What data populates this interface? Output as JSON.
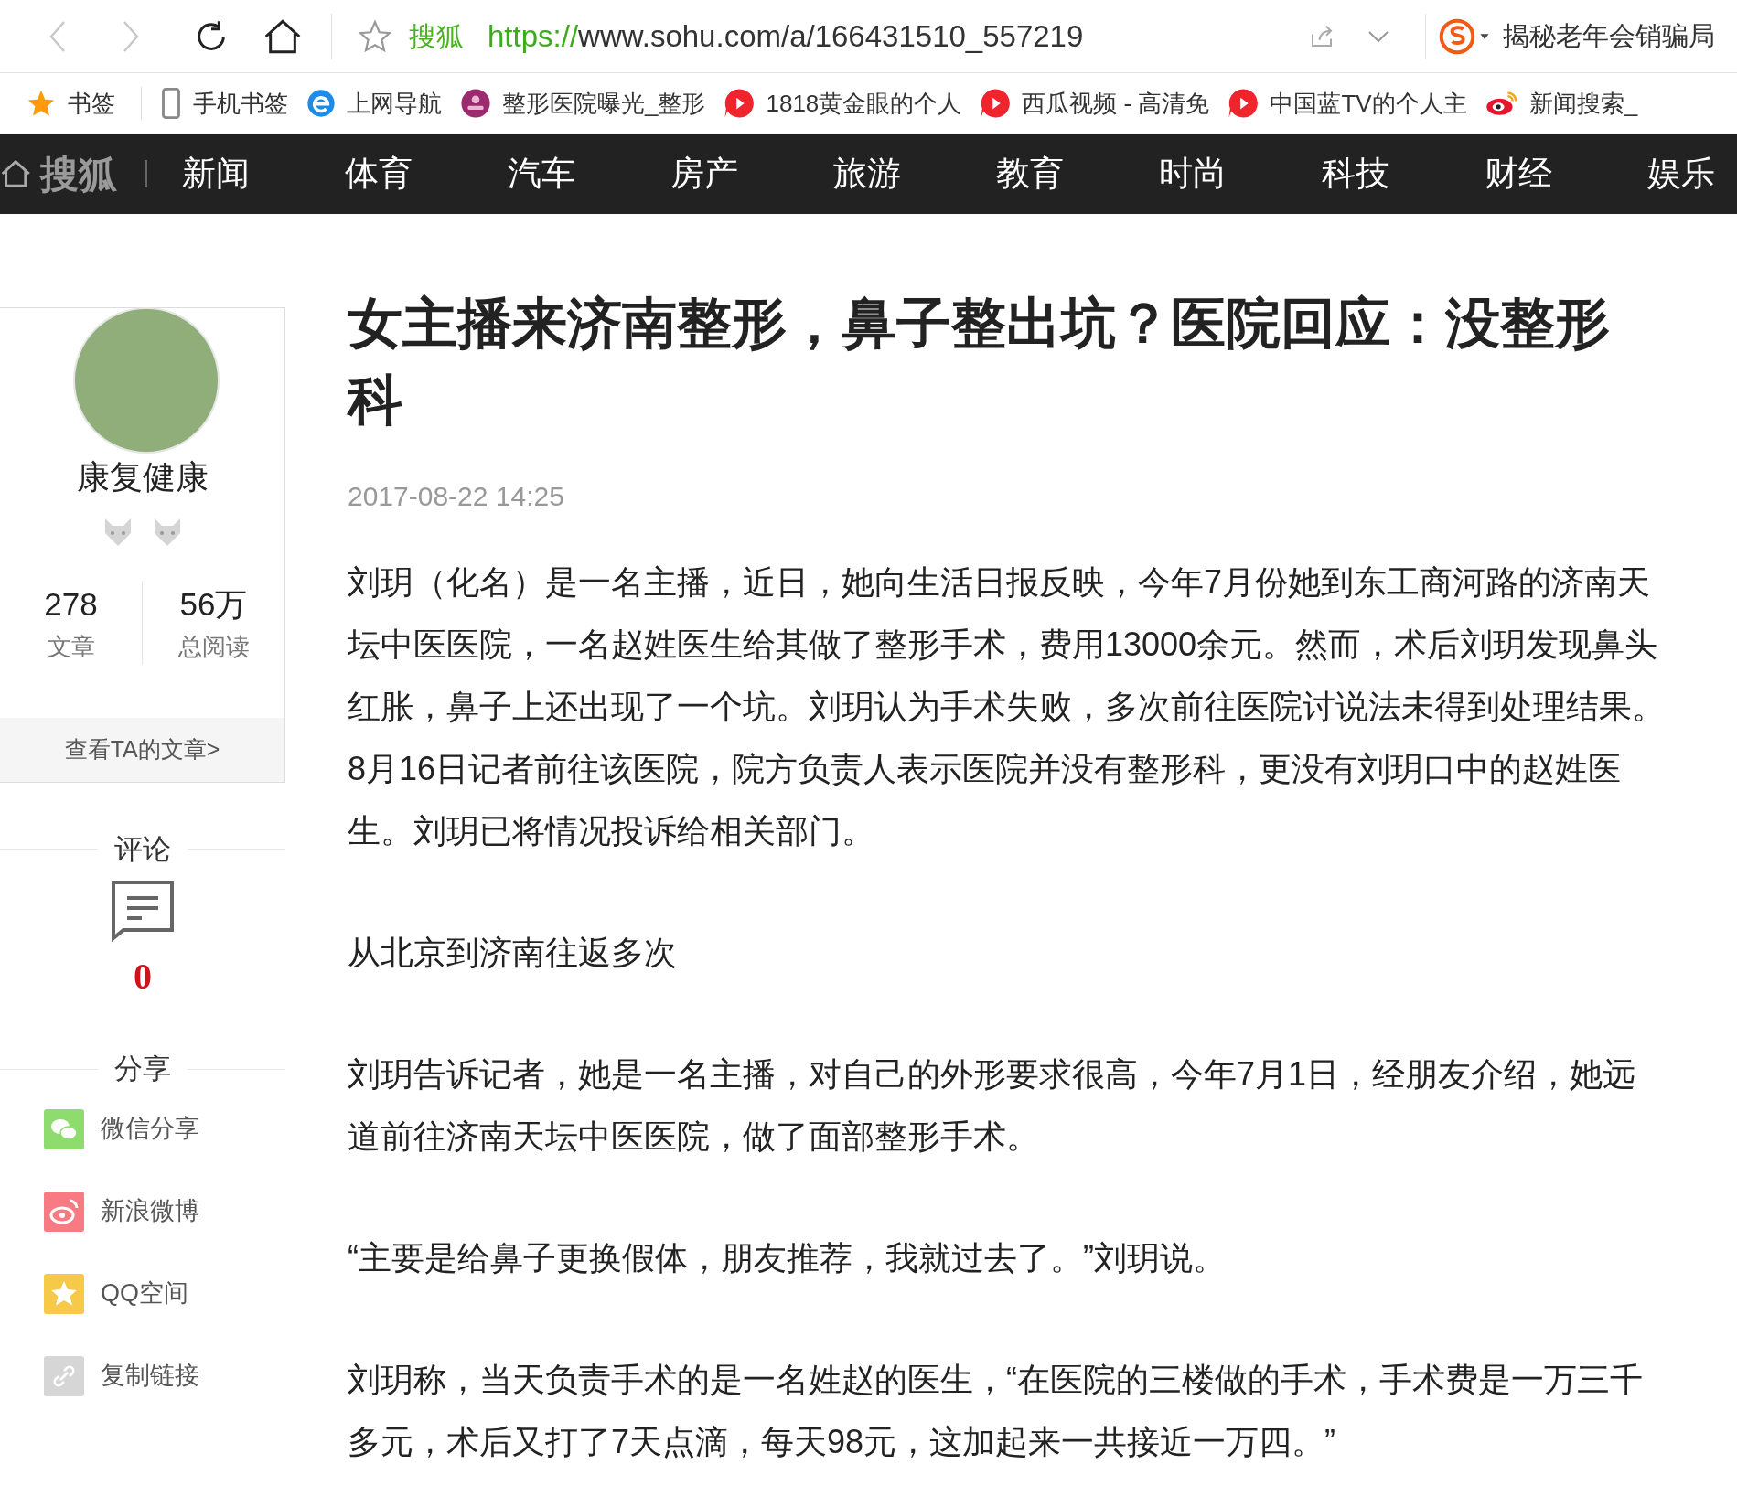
{
  "toolbar": {
    "back_disabled": true,
    "forward_disabled": true,
    "site_name": "搜狐",
    "url_scheme": "https://",
    "url_rest": "www.sohu.com/a/166431510_557219",
    "search_hint": "揭秘老年会销骗局"
  },
  "bookmarks": [
    {
      "kind": "star",
      "label": "书签"
    },
    {
      "kind": "phone",
      "label": "手机书签"
    },
    {
      "kind": "ie",
      "label": "上网导航"
    },
    {
      "kind": "badge",
      "label": "整形医院曝光_整形"
    },
    {
      "kind": "play",
      "label": "1818黄金眼的个人"
    },
    {
      "kind": "play",
      "label": "西瓜视频 - 高清免"
    },
    {
      "kind": "play",
      "label": "中国蓝TV的个人主"
    },
    {
      "kind": "weibo",
      "label": "新闻搜索_"
    }
  ],
  "nav": {
    "logo": "搜狐",
    "items": [
      "新闻",
      "体育",
      "汽车",
      "房产",
      "旅游",
      "教育",
      "时尚",
      "科技",
      "财经",
      "娱乐"
    ]
  },
  "author": {
    "name": "康复健康",
    "stats": [
      {
        "value": "278",
        "label": "文章"
      },
      {
        "value": "56万",
        "label": "总阅读"
      }
    ],
    "more_link": "查看TA的文章>"
  },
  "comments": {
    "heading": "评论",
    "count": "0"
  },
  "share": {
    "heading": "分享",
    "items": [
      {
        "kind": "wechat",
        "label": "微信分享"
      },
      {
        "kind": "weibo",
        "label": "新浪微博"
      },
      {
        "kind": "qzone",
        "label": "QQ空间"
      },
      {
        "kind": "link",
        "label": "复制链接"
      }
    ]
  },
  "article": {
    "title": "女主播来济南整形，鼻子整出坑？医院回应：没整形科",
    "date": "2017-08-22 14:25",
    "paragraphs": [
      "刘玥（化名）是一名主播，近日，她向生活日报反映，今年7月份她到东工商河路的济南天坛中医医院，一名赵姓医生给其做了整形手术，费用13000余元。然而，术后刘玥发现鼻头红胀，鼻子上还出现了一个坑。刘玥认为手术失败，多次前往医院讨说法未得到处理结果。8月16日记者前往该医院，院方负责人表示医院并没有整形科，更没有刘玥口中的赵姓医生。刘玥已将情况投诉给相关部门。",
      "从北京到济南往返多次",
      "刘玥告诉记者，她是一名主播，对自己的外形要求很高，今年7月1日，经朋友介绍，她远道前往济南天坛中医医院，做了面部整形手术。",
      "“主要是给鼻子更换假体，朋友推荐，我就过去了。”刘玥说。",
      "刘玥称，当天负责手术的是一名姓赵的医生，“在医院的三楼做的手术，手术费是一万三千多元，术后又打了7天点滴，每天98元，这加起来一共接近一万四。”"
    ]
  }
}
